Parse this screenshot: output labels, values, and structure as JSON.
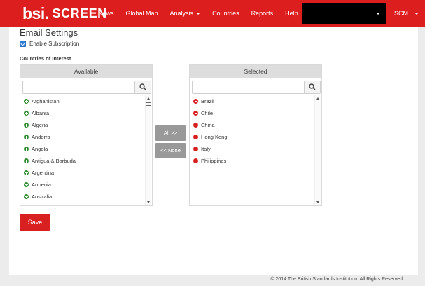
{
  "navbar": {
    "brand_bsi": "bsi.",
    "brand_screen": "SCREEN",
    "items": [
      {
        "label": "News",
        "dropdown": false
      },
      {
        "label": "Global Map",
        "dropdown": false
      },
      {
        "label": "Analysis",
        "dropdown": true
      },
      {
        "label": "Countries",
        "dropdown": false
      },
      {
        "label": "Reports",
        "dropdown": false
      },
      {
        "label": "Help",
        "dropdown": true
      }
    ],
    "user_label": "SCM",
    "accent_color": "#dd1e1e"
  },
  "page": {
    "title": "Email Settings",
    "enable_subscription_label": "Enable Subscription",
    "enable_subscription_checked": true,
    "countries_label": "Countries of Interest"
  },
  "available": {
    "header": "Available",
    "search_value": "",
    "items": [
      "Afghanistan",
      "Albania",
      "Algeria",
      "Andorra",
      "Angola",
      "Antigua & Barbuda",
      "Argentina",
      "Armenia",
      "Australia"
    ]
  },
  "selected": {
    "header": "Selected",
    "search_value": "",
    "items": [
      "Brazil",
      "Chile",
      "China",
      "Hong Kong",
      "Italy",
      "Philippines"
    ]
  },
  "buttons": {
    "all": "All >>",
    "none": "<< None",
    "save": "Save"
  },
  "footer": {
    "copyright": "© 2014 The British Standards Institution. All Rights Reserved."
  }
}
